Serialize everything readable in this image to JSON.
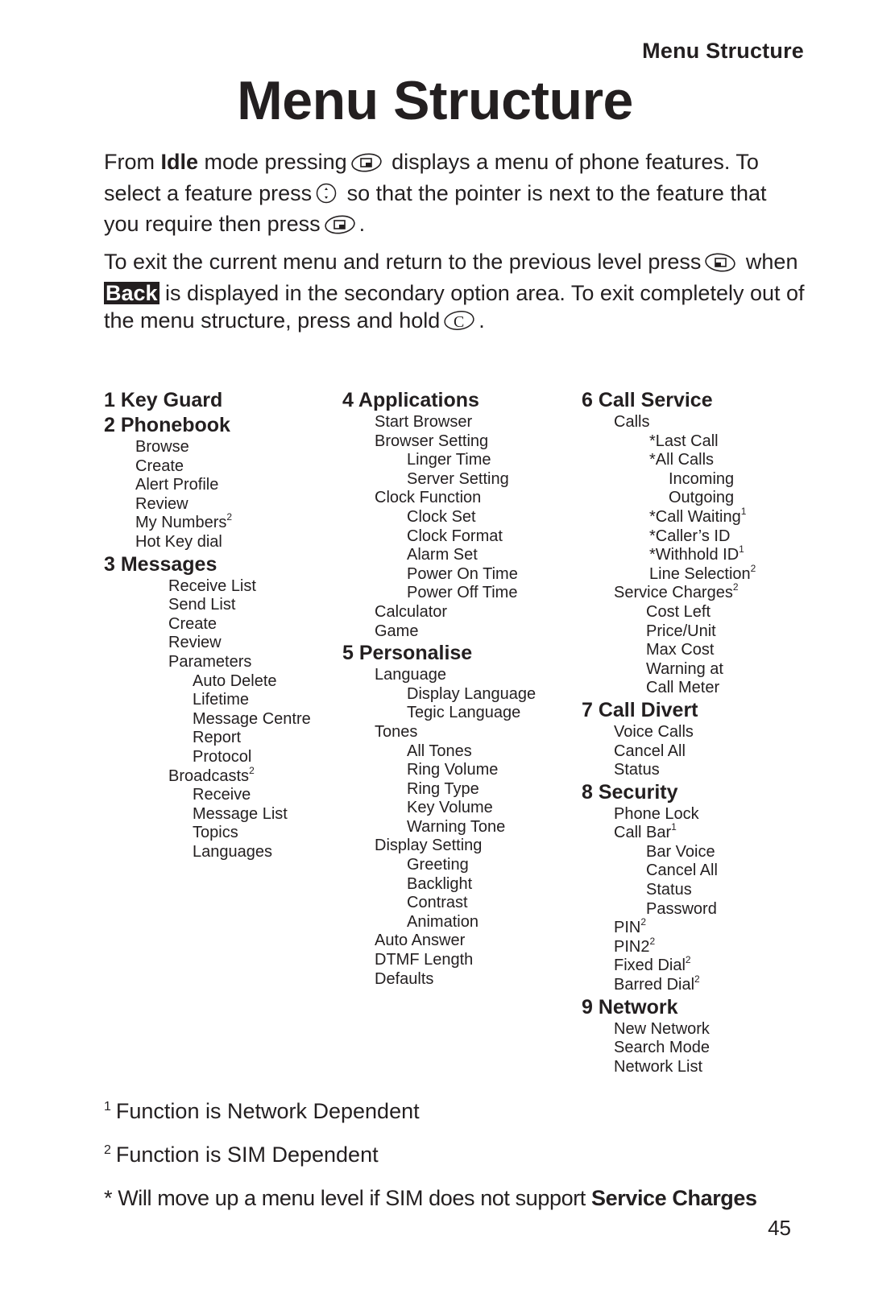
{
  "header": {
    "running_title": "Menu Structure",
    "page_title": "Menu Structure"
  },
  "intro": {
    "p1_a": "From ",
    "p1_idle": "Idle",
    "p1_b": " mode pressing",
    "p1_c": " displays a menu of phone features. To select a feature press",
    "p1_d": " so that the pointer is next to the feature that you require then press",
    "p1_e": ".",
    "p2_a": "To exit the current menu and return to the previous level press",
    "p2_b": " when ",
    "p2_back": "Back",
    "p2_c": " is displayed in the secondary option area. To exit completely out of the menu structure, press and hold",
    "p2_d": ".",
    "icons": {
      "menu_key": "left-softkey-icon",
      "nav_key": "navigation-key-icon",
      "back_key": "right-softkey-icon",
      "clear_key": "clear-key-icon"
    }
  },
  "menus": {
    "m1": {
      "title": "1 Key Guard"
    },
    "m2": {
      "title": "2 Phonebook",
      "items": [
        "Browse",
        "Create",
        "Alert Profile",
        "Review",
        "My Numbers",
        "Hot Key dial"
      ],
      "my_numbers_note": "2"
    },
    "m3": {
      "title": "3 Messages",
      "items": [
        "Receive List",
        "Send List",
        "Create",
        "Review",
        "Parameters"
      ],
      "parameters": [
        "Auto Delete",
        "Lifetime",
        "Message Centre",
        "Report",
        "Protocol"
      ],
      "broadcasts": "Broadcasts",
      "broadcasts_note": "2",
      "broadcasts_items": [
        "Receive",
        "Message List",
        "Topics",
        "Languages"
      ]
    },
    "m4": {
      "title": "4 Applications",
      "start_browser": "Start Browser",
      "browser_setting": "Browser Setting",
      "browser_items": [
        "Linger Time",
        "Server Setting"
      ],
      "clock_function": "Clock Function",
      "clock_items": [
        "Clock Set",
        "Clock Format",
        "Alarm Set",
        "Power On Time",
        "Power Off Time"
      ],
      "calculator": "Calculator",
      "game": "Game"
    },
    "m5": {
      "title": "5 Personalise",
      "language": "Language",
      "language_items": [
        "Display Language",
        "Tegic Language"
      ],
      "tones": "Tones",
      "tones_items": [
        "All Tones",
        "Ring Volume",
        "Ring Type",
        "Key Volume",
        "Warning Tone"
      ],
      "display_setting": "Display Setting",
      "display_items": [
        "Greeting",
        "Backlight",
        "Contrast",
        "Animation"
      ],
      "others": [
        "Auto Answer",
        "DTMF Length",
        "Defaults"
      ]
    },
    "m6": {
      "title": "6 Call Service",
      "calls": "Calls",
      "last_call": "*Last Call",
      "all_calls": "*All Calls",
      "all_calls_items": [
        "Incoming",
        "Outgoing"
      ],
      "call_waiting": "*Call Waiting",
      "call_waiting_note": "1",
      "callers_id": "*Caller’s ID",
      "withhold_id": "*Withhold ID",
      "withhold_id_note": "1",
      "line_selection": "Line Selection",
      "line_selection_note": "2",
      "service_charges": "Service Charges",
      "service_charges_note": "2",
      "service_charges_items": [
        "Cost Left",
        "Price/Unit",
        "Max Cost",
        "Warning at",
        "Call Meter"
      ]
    },
    "m7": {
      "title": "7 Call Divert",
      "items": [
        "Voice Calls",
        "Cancel All",
        "Status"
      ]
    },
    "m8": {
      "title": "8 Security",
      "phone_lock": "Phone Lock",
      "call_bar": "Call Bar",
      "call_bar_note": "1",
      "call_bar_items": [
        "Bar Voice",
        "Cancel All",
        "Status",
        "Password"
      ],
      "pin": "PIN",
      "pin_note": "2",
      "pin2": "PIN2",
      "pin2_note": "2",
      "fixed_dial": "Fixed Dial",
      "fixed_dial_note": "2",
      "barred_dial": "Barred Dial",
      "barred_dial_note": "2"
    },
    "m9": {
      "title": "9 Network",
      "items": [
        "New Network",
        "Search Mode",
        "Network List"
      ]
    }
  },
  "footnotes": {
    "n1_mark": "1",
    "n1_text": "Function is Network Dependent",
    "n2_mark": "2",
    "n2_text": "Function is SIM Dependent",
    "n3_text": "* Will move up a menu level if SIM does not support ",
    "n3_bold": "Service Charges"
  },
  "page_number": "45"
}
